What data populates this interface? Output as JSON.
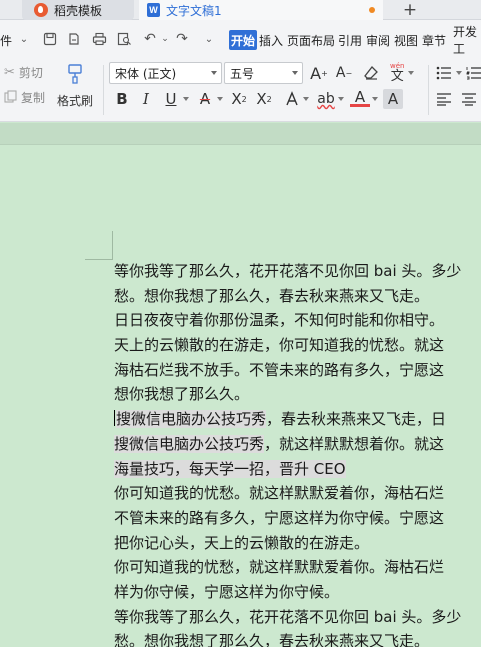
{
  "tabs": [
    {
      "label": "稻壳模板"
    },
    {
      "label": "文字文稿1"
    }
  ],
  "new_tab_symbol": "+",
  "menu": [
    "开始",
    "插入",
    "页面布局",
    "引用",
    "审阅",
    "视图",
    "章节",
    "开发工"
  ],
  "menu_left_fragment": "件",
  "ribbon": {
    "cut": "剪切",
    "copy": "复制",
    "format_painter": "格式刷",
    "font_name": "宋体 (正文)",
    "font_size": "五号",
    "wen_label": "wén"
  },
  "document": {
    "lines": [
      {
        "text": "等你我等了那么久，花开花落不见你回 bai 头。多少"
      },
      {
        "text": "愁。想你我想了那么久，春去秋来燕来又飞走。"
      },
      {
        "text": "日日夜夜守着你那份温柔，不知何时能和你相守。"
      },
      {
        "text": "天上的云懒散的在游走，你可知道我的忧愁。就这"
      },
      {
        "text": "海枯石烂我不放手。不管未来的路有多久，宁愿这"
      },
      {
        "text": "想你我想了那么久。"
      },
      {
        "text": "搜微信电脑办公技巧秀",
        "rest": "，春去秋来燕来又飞走，日",
        "highlight": true,
        "cursor": true
      },
      {
        "text": "搜微信电脑办公技巧秀",
        "rest": "，就这样默默想着你。就这",
        "highlight": true
      },
      {
        "text": "海量技巧，每天学一招，晋升 CEO",
        "rest": "",
        "highlight": true
      },
      {
        "text": "你可知道我的忧愁。就这样默默爱着你，海枯石烂"
      },
      {
        "text": "不管未来的路有多久，宁愿这样为你守候。宁愿这"
      },
      {
        "text": "把你记心头，天上的云懒散的在游走。"
      },
      {
        "text": "你可知道我的忧愁，就这样默默爱着你。海枯石烂"
      },
      {
        "text": "样为你守候，宁愿这样为你守候。"
      },
      {
        "text": "等你我等了那么久，花开花落不见你回 bai 头。多少"
      },
      {
        "text": "愁。想你我想了那么久，春去秋来燕来又飞走。"
      }
    ]
  },
  "colors": {
    "accent": "#2f6fd6",
    "page_bg": "#cce8cf",
    "highlight": "#dcdcdc"
  }
}
